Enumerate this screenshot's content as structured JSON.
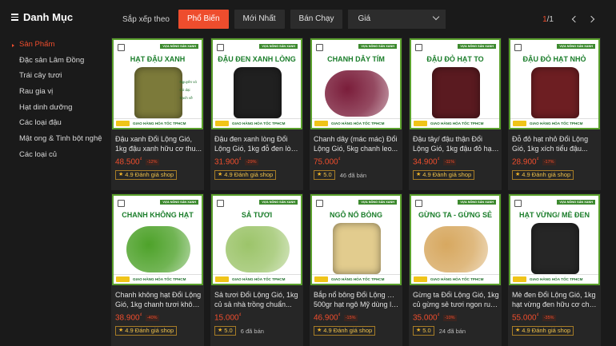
{
  "sidebar": {
    "title": "Danh Mục",
    "items": [
      {
        "label": "Sản Phẩm",
        "active": true
      },
      {
        "label": "Đặc sản Lâm Đồng",
        "active": false
      },
      {
        "label": "Trái cây tươi",
        "active": false
      },
      {
        "label": "Rau gia vị",
        "active": false
      },
      {
        "label": "Hạt dinh dưỡng",
        "active": false
      },
      {
        "label": "Các loại đậu",
        "active": false
      },
      {
        "label": "Mật ong & Tinh bột nghệ",
        "active": false
      },
      {
        "label": "Các loại củ",
        "active": false
      }
    ]
  },
  "sortbar": {
    "label": "Sắp xếp theo",
    "options": [
      "Phổ Biến",
      "Mới Nhất",
      "Bán Chạy"
    ],
    "active_index": 0,
    "price_select": "Giá",
    "page_current": "1",
    "page_total": "/1"
  },
  "colors": {
    "accent": "#ee4d2d",
    "background": "#1a1a1a",
    "card": "#262626",
    "frame": "#5aa02c"
  },
  "products": [
    {
      "image_title": "HẠT ĐẬU XANH",
      "name1": "Đậu xanh Đổi Lộng Gió,",
      "name2": "1kg đậu xanh hữu cơ thu...",
      "price": "48.500",
      "currency": "₫",
      "discount": "-12%",
      "rating": "4.9 Đánh giá shop",
      "sold": "",
      "blob": "#7c7a3a",
      "checks": true
    },
    {
      "image_title": "ĐẬU ĐEN XANH LÒNG",
      "name1": "Đậu đen xanh lòng Đổi",
      "name2": "Lộng Gió, 1kg đỗ đen lòn...",
      "price": "31.900",
      "currency": "₫",
      "discount": "-29%",
      "rating": "4.9 Đánh giá shop",
      "sold": "",
      "blob": "#202020",
      "checks": false
    },
    {
      "image_title": "CHANH DÂY TÍM",
      "name1": "Chanh dây (mác mác) Đổi",
      "name2": "Lộng Gió, 5kg chanh leo...",
      "price": "75.000",
      "currency": "₫",
      "discount": "",
      "rating": "5.0",
      "sold": "46 đã bán",
      "blob": "#7a1d3a",
      "checks": false
    },
    {
      "image_title": "ĐẬU ĐỎ HẠT TO",
      "name1": "Đậu tây/ đậu thận Đổi",
      "name2": "Lộng Gió, 1kg đậu đỏ hạt to...",
      "price": "34.900",
      "currency": "₫",
      "discount": "-11%",
      "rating": "4.9 Đánh giá shop",
      "sold": "",
      "blob": "#5a1a20",
      "checks": false
    },
    {
      "image_title": "ĐẬU ĐỎ HẠT NHỎ",
      "name1": "Đỗ đỏ hạt nhỏ Đổi Lộng",
      "name2": "Gió, 1kg xích tiểu đậu...",
      "price": "28.900",
      "currency": "₫",
      "discount": "-17%",
      "rating": "4.9 Đánh giá shop",
      "sold": "",
      "blob": "#6d1e22",
      "checks": false
    },
    {
      "image_title": "CHANH KHÔNG HẠT",
      "name1": "Chanh không hạt Đổi Lộng",
      "name2": "Gió, 1kg chanh tươi khôn...",
      "price": "38.900",
      "currency": "₫",
      "discount": "-40%",
      "rating": "4.9 Đánh giá shop",
      "sold": "",
      "blob": "#4ea22a",
      "checks": false
    },
    {
      "image_title": "SẢ TƯƠI",
      "name1": "Sả tươi Đổi Lộng Gió, 1kg",
      "name2": "củ sả nhà trồng chuẩn...",
      "price": "15.000",
      "currency": "₫",
      "discount": "",
      "rating": "5.0",
      "sold": "6 đã bán",
      "blob": "#9cc46a",
      "checks": false
    },
    {
      "image_title": "NGÔ NỔ BỎNG",
      "name1": "Bắp nổ bông Đổi Lộng Gió,",
      "name2": "500gr hạt ngô Mỹ dùng là...",
      "price": "46.900",
      "currency": "₫",
      "discount": "-15%",
      "rating": "4.9 Đánh giá shop",
      "sold": "",
      "blob": "#e2cc8e",
      "checks": false
    },
    {
      "image_title": "GỪNG TA - GỪNG SẺ",
      "name1": "Gừng ta Đổi Lộng Gió, 1kg",
      "name2": "củ gừng sẻ tươi ngon ruộ...",
      "price": "35.000",
      "currency": "₫",
      "discount": "-10%",
      "rating": "5.0",
      "sold": "24 đã bán",
      "blob": "#d7a860",
      "checks": false
    },
    {
      "image_title": "HẠT VỪNG/ MÈ ĐEN",
      "name1": "Mè đen Đổi Lộng Gió, 1kg",
      "name2": "hạt vừng đen hữu cơ chu...",
      "price": "55.000",
      "currency": "₫",
      "discount": "-35%",
      "rating": "4.9 Đánh giá shop",
      "sold": "",
      "blob": "#262626",
      "checks": false
    }
  ],
  "image_labels": {
    "badge": "VỰA NÔNG SẢN XANH",
    "delivery": "GIAO HÀNG HỎA TỐC TPHCM",
    "checks": [
      "Nguyên vỏ",
      "Cỏ dại",
      "Sạch về"
    ]
  }
}
